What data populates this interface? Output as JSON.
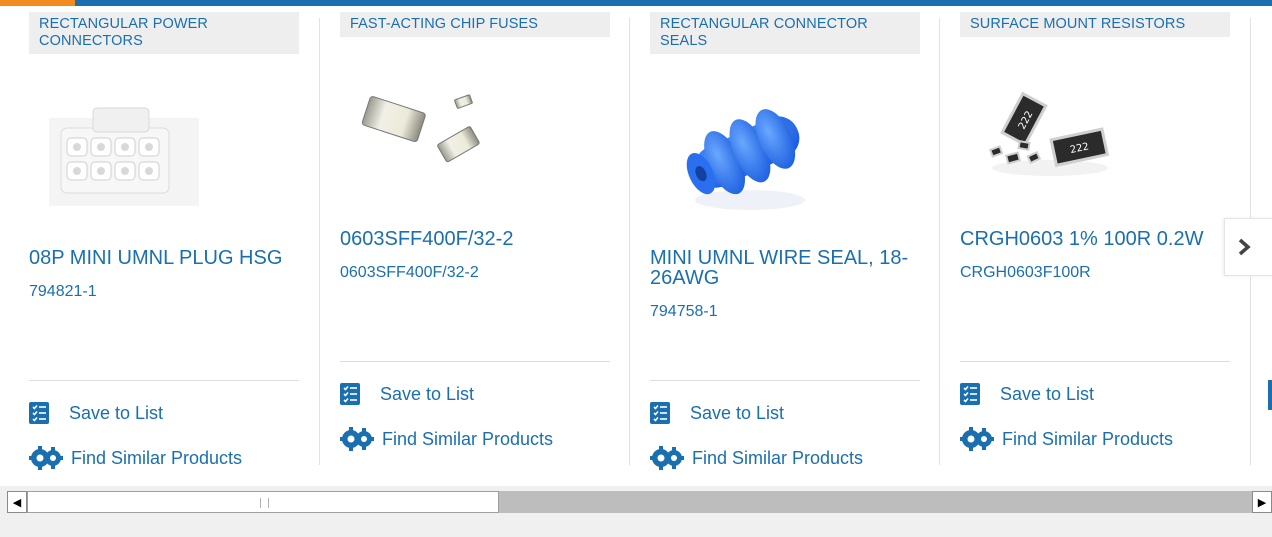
{
  "colors": {
    "brand_blue": "#1a6fb0",
    "accent_orange": "#f28c1e",
    "category_bg": "#eeeeee"
  },
  "actions": {
    "save_label": "Save to List",
    "similar_label": "Find Similar Products",
    "save_icon": "list-checklist-icon",
    "similar_icon": "gears-icon"
  },
  "products": [
    {
      "category": "RECTANGULAR POWER CONNECTORS",
      "title": "08P MINI UMNL PLUG HSG",
      "part_number": "794821-1",
      "image": "white-connector-housing"
    },
    {
      "category": "FAST-ACTING CHIP FUSES",
      "title": "0603SFF400F/32-2",
      "part_number": "0603SFF400F/32-2",
      "image": "chip-fuses"
    },
    {
      "category": "RECTANGULAR CONNECTOR SEALS",
      "title": "MINI UMNL WIRE SEAL, 18-26AWG",
      "part_number": "794758-1",
      "image": "blue-wire-seal"
    },
    {
      "category": "SURFACE MOUNT RESISTORS",
      "title": "CRGH0603 1% 100R 0.2W",
      "part_number": "CRGH0603F100R",
      "image": "smd-resistors",
      "resistor_marking": "222"
    }
  ],
  "carousel": {
    "next_icon": "chevron-right-icon",
    "next_glyph": "›"
  },
  "scrollbar": {
    "left_arrow": "◀",
    "right_arrow": "▶",
    "thumb_fraction": 0.385
  }
}
